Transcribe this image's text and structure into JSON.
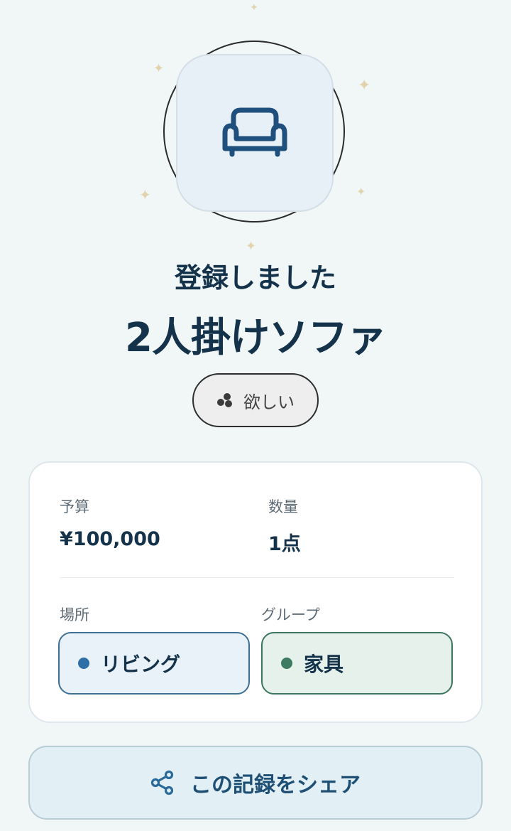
{
  "status": {
    "title": "登録しました"
  },
  "item": {
    "name": "2人掛けソファ",
    "icon": "sofa-icon"
  },
  "tag": {
    "label": "欲しい",
    "icon": "wish-icon"
  },
  "details": {
    "budget_label": "予算",
    "budget_value": "¥100,000",
    "quantity_label": "数量",
    "quantity_value": "1点",
    "location_label": "場所",
    "location_value": "リビング",
    "group_label": "グループ",
    "group_value": "家具"
  },
  "share": {
    "label": "この記録をシェア",
    "icon": "share-icon"
  },
  "colors": {
    "background": "#f1f6f7",
    "primary": "#14324a",
    "location_dot": "#2e6fa5",
    "group_dot": "#3e7b63",
    "sparkle": "#e2d3ad"
  }
}
